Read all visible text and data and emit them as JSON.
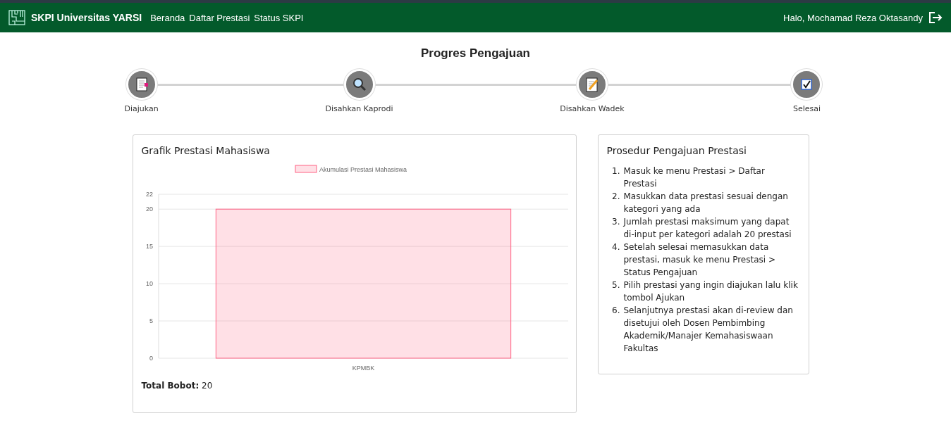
{
  "navbar": {
    "brand": "SKPI Universitas YARSI",
    "links": [
      "Beranda",
      "Daftar Prestasi",
      "Status SKPI"
    ],
    "greeting": "Halo, Mochamad Reza Oktasandy"
  },
  "title": "Progres Pengajuan",
  "steps": [
    {
      "label": "Diajukan"
    },
    {
      "label": "Disahkan Kaprodi"
    },
    {
      "label": "Disahkan Wadek"
    },
    {
      "label": "Selesai"
    }
  ],
  "chart_card": {
    "title": "Grafik Prestasi Mahasiswa",
    "chart_data": {
      "type": "bar",
      "categories": [
        "KPMBK"
      ],
      "series": [
        {
          "name": "Akumulasi Prestasi Mahasiswa",
          "color": "#ff6384",
          "values": [
            20
          ]
        }
      ],
      "ylim": [
        0,
        22
      ],
      "yticks": [
        0,
        5,
        10,
        15,
        20,
        22
      ],
      "grid": true
    },
    "total_label": "Total Bobot:",
    "total_value": "20"
  },
  "procedure": {
    "title": "Prosedur Pengajuan Prestasi",
    "items": [
      {
        "number": "1.",
        "text": "Masuk ke menu Prestasi > Daftar Prestasi"
      },
      {
        "number": "2.",
        "text": "Masukkan data prestasi sesuai dengan kategori yang ada"
      },
      {
        "number": "3.",
        "text": "Jumlah prestasi maksimum yang dapat di-input per kategori adalah 20 prestasi"
      },
      {
        "number": "4.",
        "text": "Setelah selesai memasukkan data prestasi, masuk ke menu Prestasi > Status Pengajuan"
      },
      {
        "number": "5.",
        "text": "Pilih prestasi yang ingin diajukan lalu klik tombol Ajukan"
      },
      {
        "number": "6.",
        "text": "Selanjutnya prestasi akan di-review dan disetujui oleh Dosen Pembimbing Akademik/Manajer Kemahasiswaan Fakultas"
      }
    ]
  }
}
